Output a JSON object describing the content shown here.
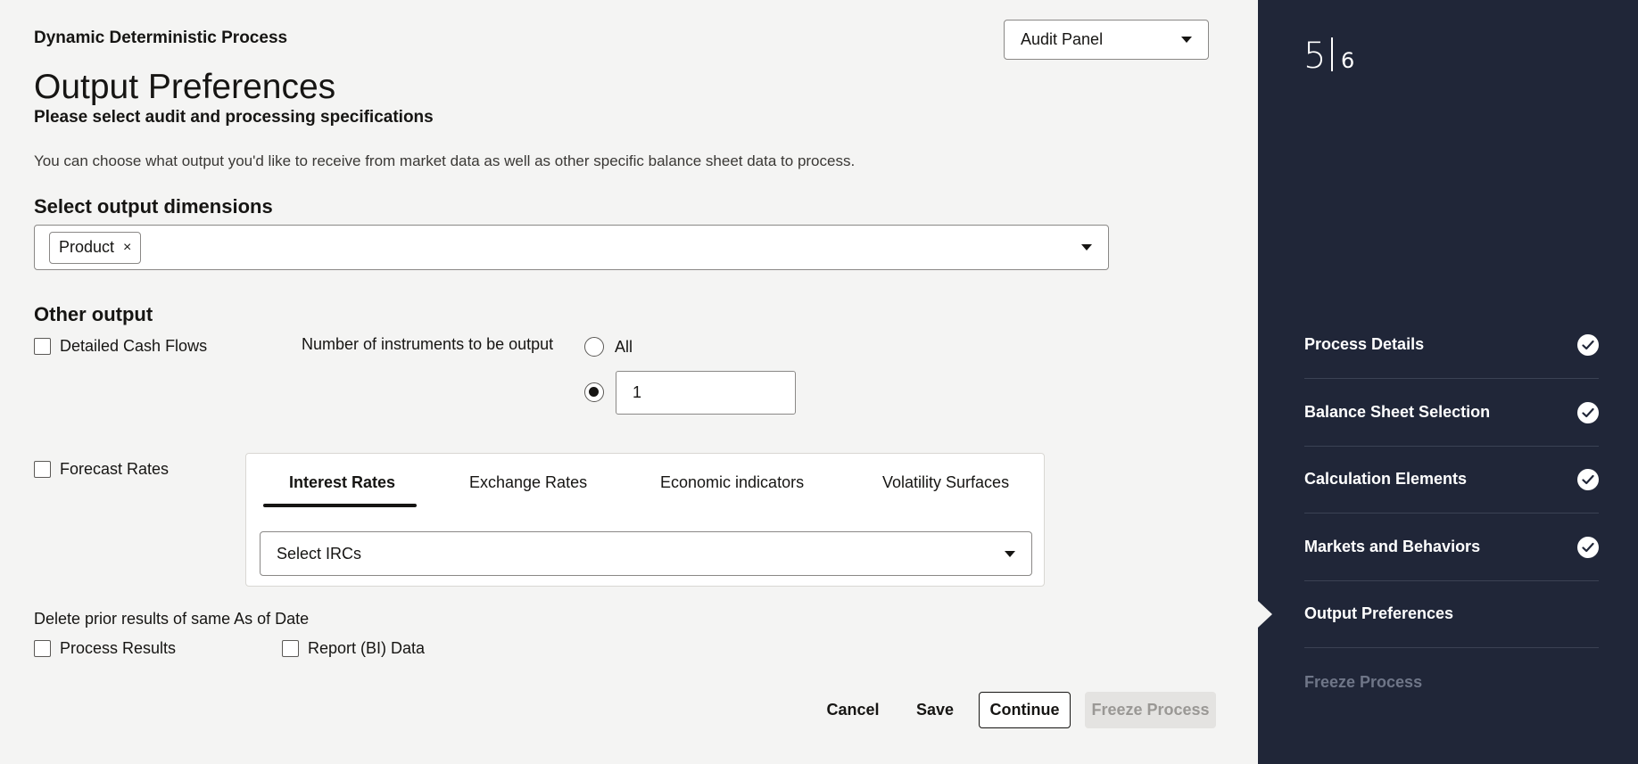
{
  "header": {
    "process_name": "Dynamic Deterministic Process",
    "panel_select": "Audit Panel"
  },
  "page": {
    "title": "Output Preferences",
    "subtitle": "Please select audit and processing specifications",
    "description": "You can choose what output you'd like to receive from market data as well as other specific balance sheet data to process."
  },
  "dimensions": {
    "label": "Select output dimensions",
    "selected": [
      "Product"
    ],
    "chip_remove": "×"
  },
  "other_output": {
    "label": "Other output",
    "detailed_cash_flows": "Detailed Cash Flows",
    "instruments_label": "Number of instruments to be output",
    "radio_all": "All",
    "instruments_value": "1",
    "forecast_rates": "Forecast Rates"
  },
  "tabs": {
    "items": [
      "Interest Rates",
      "Exchange Rates",
      "Economic indicators",
      "Volatility Surfaces"
    ],
    "active": "Interest Rates",
    "irc_select": "Select IRCs"
  },
  "delete_prior": {
    "label": "Delete prior results of same As of Date",
    "process_results": "Process Results",
    "report_data": "Report (BI) Data"
  },
  "buttons": {
    "cancel": "Cancel",
    "save": "Save",
    "continue": "Continue",
    "freeze": "Freeze Process"
  },
  "sidebar": {
    "current_step": "5",
    "total_steps": "6",
    "steps": [
      {
        "label": "Process Details",
        "state": "complete"
      },
      {
        "label": "Balance Sheet Selection",
        "state": "complete"
      },
      {
        "label": "Calculation Elements",
        "state": "complete"
      },
      {
        "label": "Markets and Behaviors",
        "state": "complete"
      },
      {
        "label": "Output Preferences",
        "state": "current"
      },
      {
        "label": "Freeze Process",
        "state": "upcoming"
      }
    ]
  },
  "colors": {
    "sidebar_bg": "#202638",
    "page_bg": "#f4f4f3",
    "disabled_button_bg": "#e4e3e1"
  }
}
